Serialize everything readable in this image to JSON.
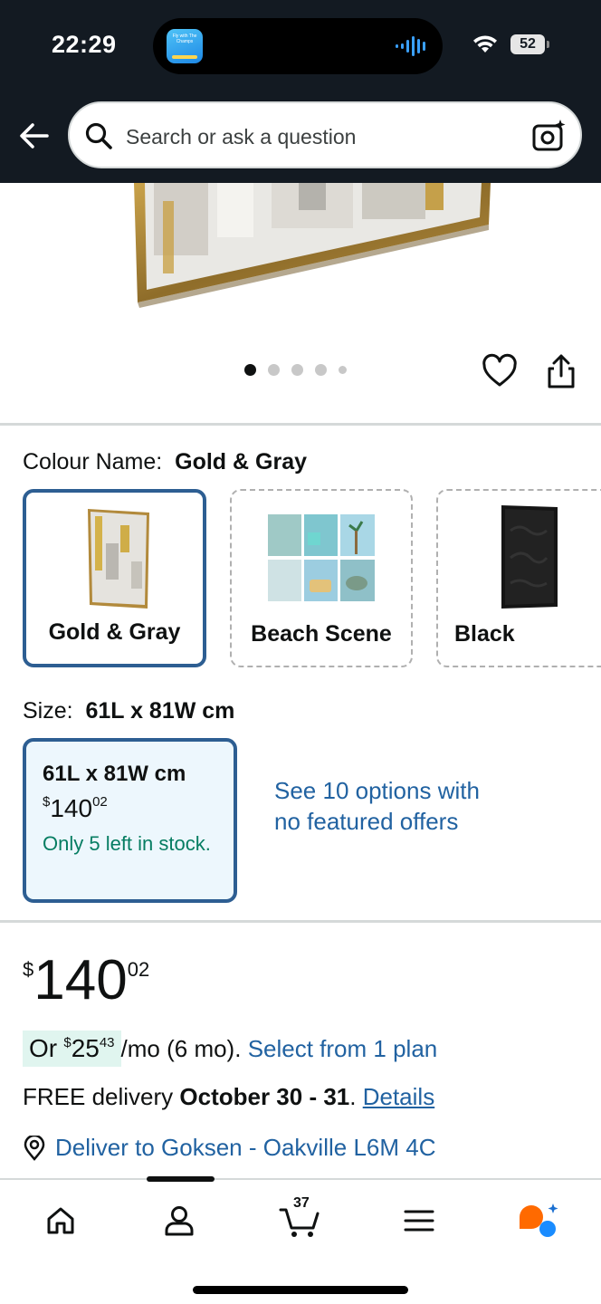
{
  "status_bar": {
    "time": "22:29",
    "island_app_text": "Fly with The Champs",
    "battery": "52"
  },
  "header": {
    "search_placeholder": "Search or ask a question"
  },
  "gallery": {
    "dots_total": 5,
    "active_dot": 1
  },
  "colour": {
    "label": "Colour Name:",
    "selected": "Gold & Gray",
    "options": [
      {
        "name": "Gold & Gray",
        "selected": true
      },
      {
        "name": "Beach Scene",
        "selected": false
      },
      {
        "name": "Black",
        "selected": false
      }
    ]
  },
  "size": {
    "label": "Size:",
    "selected": "61L x 81W cm",
    "card": {
      "title": "61L x 81W cm",
      "currency": "$",
      "price_whole": "140",
      "price_fraction": "02",
      "stock": "Only 5 left in stock."
    },
    "see_options": "See 10 options with no featured offers"
  },
  "pricing": {
    "currency": "$",
    "whole": "140",
    "fraction": "02",
    "installment_prefix": "Or",
    "installment_currency": "$",
    "installment_whole": "25",
    "installment_fraction": "43",
    "installment_suffix": "/mo (6 mo).",
    "plan_link": "Select from 1 plan"
  },
  "delivery": {
    "prefix": "FREE delivery",
    "dates": "October 30 - 31",
    "period": ".",
    "details_link": "Details",
    "deliver_to": "Deliver to Goksen - Oakville L6M 4C"
  },
  "bottom_nav": {
    "cart_count": "37",
    "items": [
      "home-icon",
      "account-icon",
      "cart-icon",
      "menu-icon",
      "rufus-ai-icon"
    ]
  },
  "colors": {
    "header_bg": "#131a22",
    "link": "#2162a1",
    "selected_border": "#2d5e92",
    "stock_green": "#067d62",
    "install_badge_bg": "#e0f5ef"
  }
}
